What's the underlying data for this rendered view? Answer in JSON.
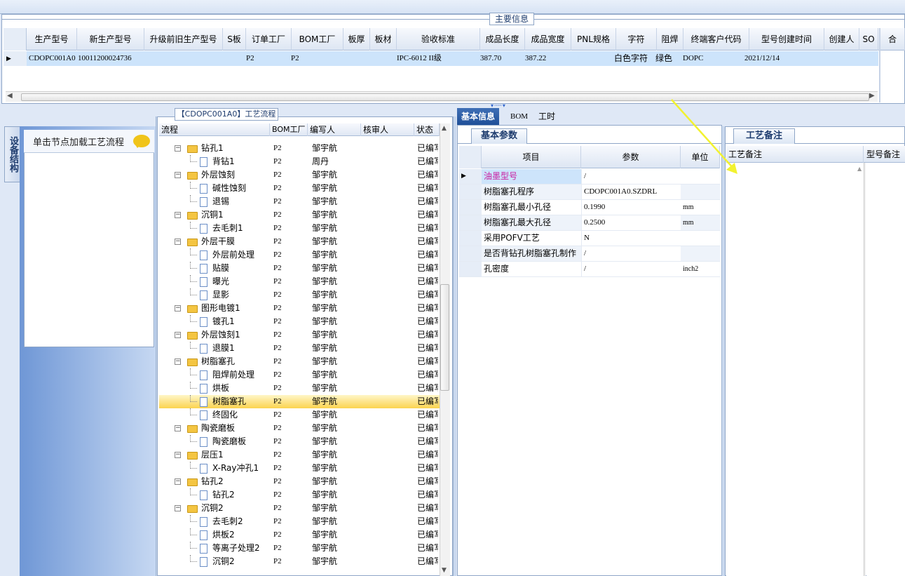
{
  "main": {
    "title": "主要信息",
    "columns": [
      "生产型号",
      "新生产型号",
      "升级前旧生产型号",
      "S板",
      "订单工厂",
      "BOM工厂",
      "板厚",
      "板材",
      "验收标准",
      "成品长度",
      "成品宽度",
      "PNL规格",
      "字符",
      "阻焊",
      "终端客户代码",
      "型号创建时间",
      "创建人",
      "SO",
      "合"
    ],
    "row": {
      "prod_model": "CDOPC001A0",
      "new_model": "10011200024736",
      "old_model": "",
      "s_board": "",
      "order_factory": "P2",
      "bom_factory": "P2",
      "thickness": "",
      "material": "",
      "standard": "IPC-6012 II级",
      "length": "387.70",
      "width": "387.22",
      "pnl": "",
      "char": "白色字符",
      "solder": "绿色",
      "customer": "DOPC",
      "created": "2021/12/14",
      "creator": "",
      "so": ""
    }
  },
  "left": {
    "tab_label": "设备结构",
    "hint": "单击节点加载工艺流程",
    "chat_icon": "chat-bubble-icon"
  },
  "flow": {
    "title": "【CDOPC001A0】工艺流程",
    "columns": [
      "流程",
      "BOM工厂",
      "编写人",
      "核审人",
      "状态"
    ],
    "rows": [
      {
        "level": 1,
        "name": "钻孔1",
        "factory": "P2",
        "writer": "邹宇航",
        "status": "已编写"
      },
      {
        "level": 2,
        "name": "背钻1",
        "factory": "P2",
        "writer": "周丹",
        "status": "已编写"
      },
      {
        "level": 1,
        "name": "外层蚀刻",
        "factory": "P2",
        "writer": "邹宇航",
        "status": "已编写"
      },
      {
        "level": 2,
        "name": "碱性蚀刻",
        "factory": "P2",
        "writer": "邹宇航",
        "status": "已编写"
      },
      {
        "level": 2,
        "name": "退锡",
        "factory": "P2",
        "writer": "邹宇航",
        "status": "已编写"
      },
      {
        "level": 1,
        "name": "沉铜1",
        "factory": "P2",
        "writer": "邹宇航",
        "status": "已编写"
      },
      {
        "level": 2,
        "name": "去毛刺1",
        "factory": "P2",
        "writer": "邹宇航",
        "status": "已编写"
      },
      {
        "level": 1,
        "name": "外层干膜",
        "factory": "P2",
        "writer": "邹宇航",
        "status": "已编写"
      },
      {
        "level": 2,
        "name": "外层前处理",
        "factory": "P2",
        "writer": "邹宇航",
        "status": "已编写"
      },
      {
        "level": 2,
        "name": "贴膜",
        "factory": "P2",
        "writer": "邹宇航",
        "status": "已编写"
      },
      {
        "level": 2,
        "name": "曝光",
        "factory": "P2",
        "writer": "邹宇航",
        "status": "已编写"
      },
      {
        "level": 2,
        "name": "显影",
        "factory": "P2",
        "writer": "邹宇航",
        "status": "已编写"
      },
      {
        "level": 1,
        "name": "图形电镀1",
        "factory": "P2",
        "writer": "邹宇航",
        "status": "已编写"
      },
      {
        "level": 2,
        "name": "镀孔1",
        "factory": "P2",
        "writer": "邹宇航",
        "status": "已编写"
      },
      {
        "level": 1,
        "name": "外层蚀刻1",
        "factory": "P2",
        "writer": "邹宇航",
        "status": "已编写"
      },
      {
        "level": 2,
        "name": "退膜1",
        "factory": "P2",
        "writer": "邹宇航",
        "status": "已编写"
      },
      {
        "level": 1,
        "name": "树脂塞孔",
        "factory": "P2",
        "writer": "邹宇航",
        "status": "已编写"
      },
      {
        "level": 2,
        "name": "阻焊前处理",
        "factory": "P2",
        "writer": "邹宇航",
        "status": "已编写"
      },
      {
        "level": 2,
        "name": "烘板",
        "factory": "P2",
        "writer": "邹宇航",
        "status": "已编写"
      },
      {
        "level": 2,
        "name": "树脂塞孔",
        "factory": "P2",
        "writer": "邹宇航",
        "status": "已编写",
        "selected": true
      },
      {
        "level": 2,
        "name": "终固化",
        "factory": "P2",
        "writer": "邹宇航",
        "status": "已编写"
      },
      {
        "level": 1,
        "name": "陶瓷磨板",
        "factory": "P2",
        "writer": "邹宇航",
        "status": "已编写"
      },
      {
        "level": 2,
        "name": "陶瓷磨板",
        "factory": "P2",
        "writer": "邹宇航",
        "status": "已编写"
      },
      {
        "level": 1,
        "name": "层压1",
        "factory": "P2",
        "writer": "邹宇航",
        "status": "已编写"
      },
      {
        "level": 2,
        "name": "X-Ray冲孔1",
        "factory": "P2",
        "writer": "邹宇航",
        "status": "已编写"
      },
      {
        "level": 1,
        "name": "钻孔2",
        "factory": "P2",
        "writer": "邹宇航",
        "status": "已编写"
      },
      {
        "level": 2,
        "name": "钻孔2",
        "factory": "P2",
        "writer": "邹宇航",
        "status": "已编写"
      },
      {
        "level": 1,
        "name": "沉铜2",
        "factory": "P2",
        "writer": "邹宇航",
        "status": "已编写"
      },
      {
        "level": 2,
        "name": "去毛刺2",
        "factory": "P2",
        "writer": "邹宇航",
        "status": "已编写"
      },
      {
        "level": 2,
        "name": "烘板2",
        "factory": "P2",
        "writer": "邹宇航",
        "status": "已编写"
      },
      {
        "level": 2,
        "name": "等离子处理2",
        "factory": "P2",
        "writer": "邹宇航",
        "status": "已编写"
      },
      {
        "level": 2,
        "name": "沉铜2",
        "factory": "P2",
        "writer": "邹宇航",
        "status": "已编写"
      }
    ]
  },
  "info": {
    "tabs": [
      "基本信息",
      "BOM",
      "工时"
    ],
    "param_tab": "基本参数",
    "columns": [
      "项目",
      "参数",
      "单位"
    ],
    "rows": [
      {
        "item": "油墨型号",
        "value": "/",
        "unit": ""
      },
      {
        "item": "树脂塞孔程序",
        "value": "CDOPC001A0.SZDRL",
        "unit": ""
      },
      {
        "item": "树脂塞孔最小孔径",
        "value": "0.1990",
        "unit": "mm"
      },
      {
        "item": "树脂塞孔最大孔径",
        "value": "0.2500",
        "unit": "mm"
      },
      {
        "item": "采用POFV工艺",
        "value": "N",
        "unit": ""
      },
      {
        "item": "是否背钻孔树脂塞孔制作",
        "value": "/",
        "unit": ""
      },
      {
        "item": "孔密度",
        "value": "/",
        "unit": "inch2"
      }
    ],
    "highlight_color": "#c81ea0"
  },
  "remark": {
    "tab": "工艺备注",
    "columns": [
      "工艺备注",
      "型号备注"
    ]
  },
  "colors": {
    "selection": "#cde4fb",
    "tab_active": "#1f4f98",
    "arrow": "#f2f230"
  }
}
